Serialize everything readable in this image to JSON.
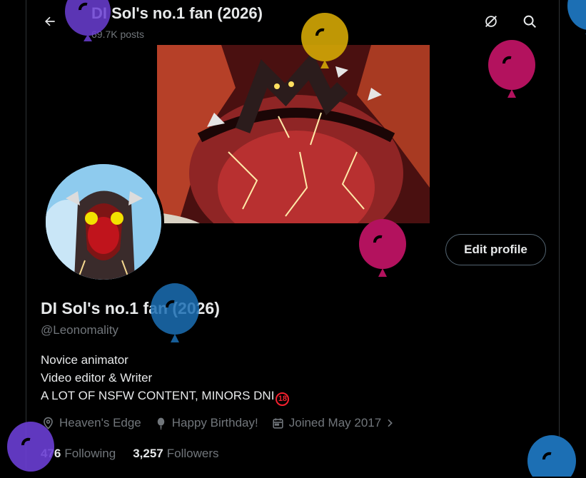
{
  "header": {
    "title": "DI Sol's no.1 fan (2026)",
    "posts": "69.7K posts"
  },
  "profile": {
    "display_name": "DI Sol's no.1 fan (2026)",
    "handle": "@Leonomality",
    "edit_label": "Edit profile",
    "bio": [
      "Novice animator",
      "Video editor & Writer",
      "A LOT OF NSFW CONTENT, MINORS DNI"
    ],
    "bio_badge": "18",
    "location": "Heaven's Edge",
    "birthday": "Happy Birthday!",
    "joined": "Joined May 2017"
  },
  "stats": {
    "following_count": "476",
    "following_label": "Following",
    "followers_count": "3,257",
    "followers_label": "Followers"
  },
  "colors": {
    "accent": "#1d9bf0",
    "balloon_purple": "#6b3fd4",
    "balloon_yellow": "#d4a806",
    "balloon_magenta": "#b3125e",
    "balloon_blue": "#1c6fb4"
  },
  "icons": [
    "back-arrow-icon",
    "grok-icon",
    "search-icon",
    "location-icon",
    "balloon-icon",
    "calendar-icon",
    "chevron-right-icon"
  ]
}
